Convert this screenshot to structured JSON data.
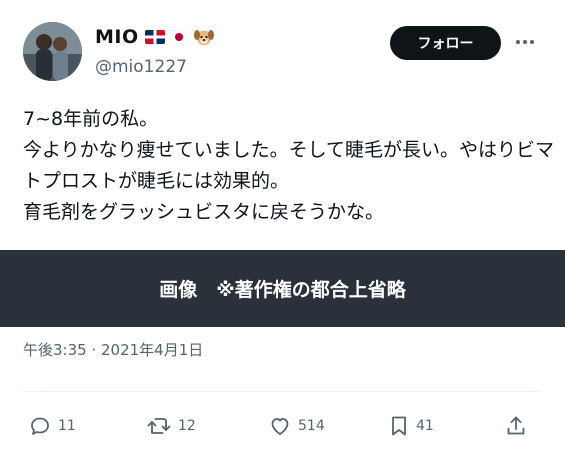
{
  "user": {
    "display_name": "MIO",
    "handle": "@mio1227",
    "badges": [
      "flag-dominican-republic-icon",
      "flag-japan-icon",
      "dog-face-icon"
    ]
  },
  "header": {
    "follow_label": "フォロー",
    "more_icon": "more-horizontal-icon"
  },
  "tweet": {
    "text": "7~8年前の私。\n今よりかなり痩せていました。そして睫毛が長い。やはりビマトプロストが睫毛には効果的。\n育毛剤をグラッシュビスタに戻そうかな。",
    "media_caption": "画像　※著作権の都合上省略",
    "timestamp": "午後3:35 · 2021年4月1日"
  },
  "actions": {
    "replies": "11",
    "retweets": "12",
    "likes": "514",
    "bookmarks": "41"
  },
  "colors": {
    "text": "#0f1419",
    "secondary": "#536471",
    "banner": "#2b313b",
    "button": "#0f1419"
  }
}
